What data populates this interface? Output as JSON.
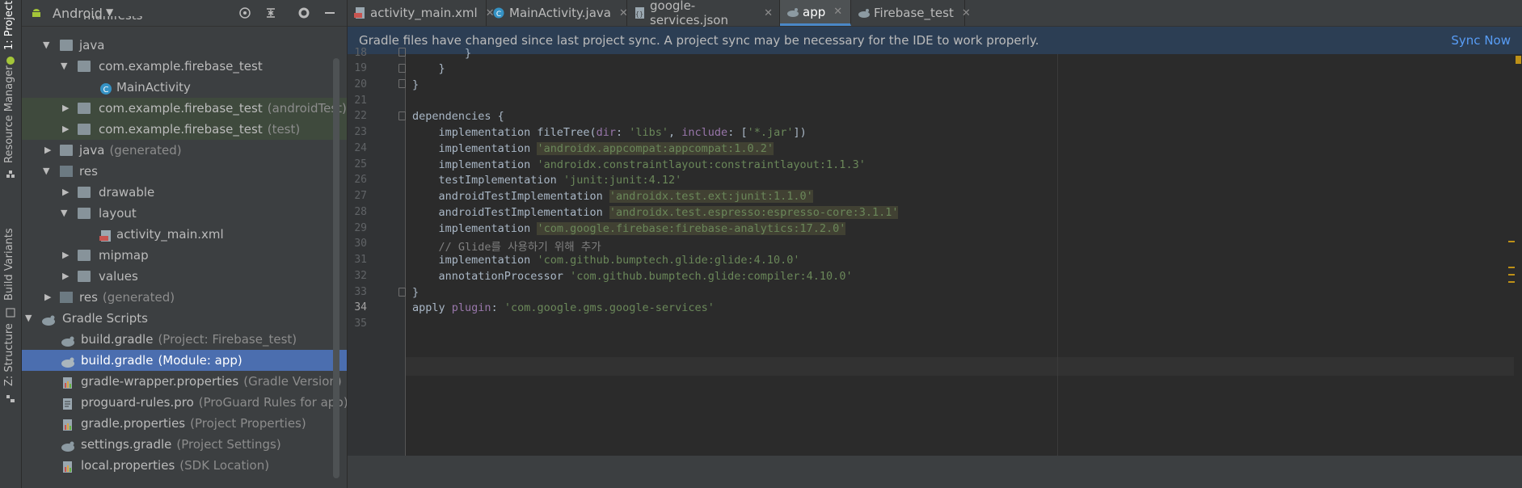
{
  "toolstrip": {
    "tabs": [
      {
        "label": "1: Project"
      },
      {
        "label": "Resource Manager"
      },
      {
        "label": "Build Variants"
      },
      {
        "label": "Z: Structure"
      }
    ]
  },
  "project_panel": {
    "view": "Android",
    "tree": [
      {
        "label": "manifests",
        "sub": ""
      },
      {
        "label": "java",
        "sub": ""
      },
      {
        "label": "com.example.firebase_test",
        "sub": ""
      },
      {
        "label": "MainActivity",
        "sub": ""
      },
      {
        "label": "com.example.firebase_test",
        "sub": "(androidTest)"
      },
      {
        "label": "com.example.firebase_test",
        "sub": "(test)"
      },
      {
        "label": "java",
        "sub": "(generated)"
      },
      {
        "label": "res",
        "sub": ""
      },
      {
        "label": "drawable",
        "sub": ""
      },
      {
        "label": "layout",
        "sub": ""
      },
      {
        "label": "activity_main.xml",
        "sub": ""
      },
      {
        "label": "mipmap",
        "sub": ""
      },
      {
        "label": "values",
        "sub": ""
      },
      {
        "label": "res",
        "sub": "(generated)"
      },
      {
        "label": "Gradle Scripts",
        "sub": ""
      },
      {
        "label": "build.gradle",
        "sub": "(Project: Firebase_test)"
      },
      {
        "label": "build.gradle",
        "sub": "(Module: app)"
      },
      {
        "label": "gradle-wrapper.properties",
        "sub": "(Gradle Version)"
      },
      {
        "label": "proguard-rules.pro",
        "sub": "(ProGuard Rules for app)"
      },
      {
        "label": "gradle.properties",
        "sub": "(Project Properties)"
      },
      {
        "label": "settings.gradle",
        "sub": "(Project Settings)"
      },
      {
        "label": "local.properties",
        "sub": "(SDK Location)"
      }
    ]
  },
  "tabs": [
    {
      "label": "activity_main.xml"
    },
    {
      "label": "MainActivity.java"
    },
    {
      "label": "google-services.json"
    },
    {
      "label": "app"
    },
    {
      "label": "Firebase_test"
    }
  ],
  "notification": {
    "text": "Gradle files have changed since last project sync. A project sync may be necessary for the IDE to work properly.",
    "action": "Sync Now"
  },
  "editor": {
    "line_numbers": [
      "18",
      "19",
      "20",
      "21",
      "22",
      "23",
      "24",
      "25",
      "26",
      "27",
      "28",
      "29",
      "30",
      "31",
      "32",
      "33",
      "34",
      "35"
    ],
    "current_line": "34",
    "lines": {
      "l18": "        }",
      "l19": "    }",
      "l20": "}",
      "l22": "dependencies {",
      "l23_a": "    implementation fileTree(",
      "l23_b": "dir",
      "l23_c": ": ",
      "l23_d": "'libs'",
      "l23_e": ", ",
      "l23_f": "include",
      "l23_g": ": [",
      "l23_h": "'*.jar'",
      "l23_i": "])",
      "l24_a": "    implementation ",
      "l24_b": "'androidx.appcompat:appcompat:1.0.2'",
      "l25_a": "    implementation ",
      "l25_b": "'androidx.constraintlayout:constraintlayout:1.1.3'",
      "l26_a": "    testImplementation ",
      "l26_b": "'junit:junit:4.12'",
      "l27_a": "    androidTestImplementation ",
      "l27_b": "'androidx.test.ext:junit:1.1.0'",
      "l28_a": "    androidTestImplementation ",
      "l28_b": "'androidx.test.espresso:espresso-core:3.1.1'",
      "l29_a": "    implementation ",
      "l29_b": "'com.google.firebase:firebase-analytics:17.2.0'",
      "l30": "    // Glide를 사용하기 위해 추가",
      "l31_a": "    implementation ",
      "l31_b": "'com.github.bumptech.glide:glide:4.10.0'",
      "l32_a": "    annotationProcessor ",
      "l32_b": "'com.github.bumptech.glide:compiler:4.10.0'",
      "l33": "}",
      "l34_a": "apply ",
      "l34_b": "plugin",
      "l34_c": ": ",
      "l34_d": "'com.google.gms.google-services'"
    }
  },
  "colors": {
    "accent": "#4a88c7",
    "selection": "#4b6eaf",
    "string": "#6a8759",
    "link": "#589df6",
    "warning": "#be9117"
  }
}
